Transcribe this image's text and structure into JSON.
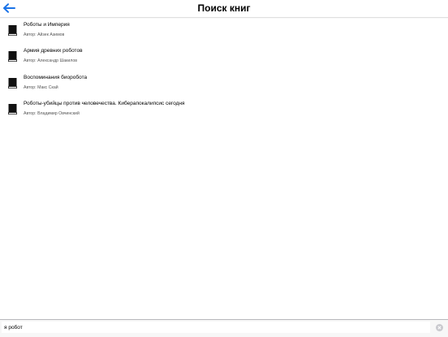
{
  "header": {
    "title": "Поиск книг",
    "back_icon": "arrow-left-icon",
    "accent_color": "#1a73e8"
  },
  "results": [
    {
      "title": "Роботы и Империя",
      "author": "Автор: Айзек Азимов",
      "icon": "book-icon"
    },
    {
      "title": "Армия древних роботов",
      "author": "Автор: Александр Шакилов",
      "icon": "book-icon"
    },
    {
      "title": "Воспоминания биоробота",
      "author": "Автор: Макс Скай",
      "icon": "book-icon"
    },
    {
      "title": "Роботы-убийцы против человечества. Киберапокалипсис сегодня",
      "author": "Автор: Владимир Овчинский",
      "icon": "book-icon"
    }
  ],
  "search": {
    "value": "я робот",
    "clear_icon": "clear-icon"
  }
}
